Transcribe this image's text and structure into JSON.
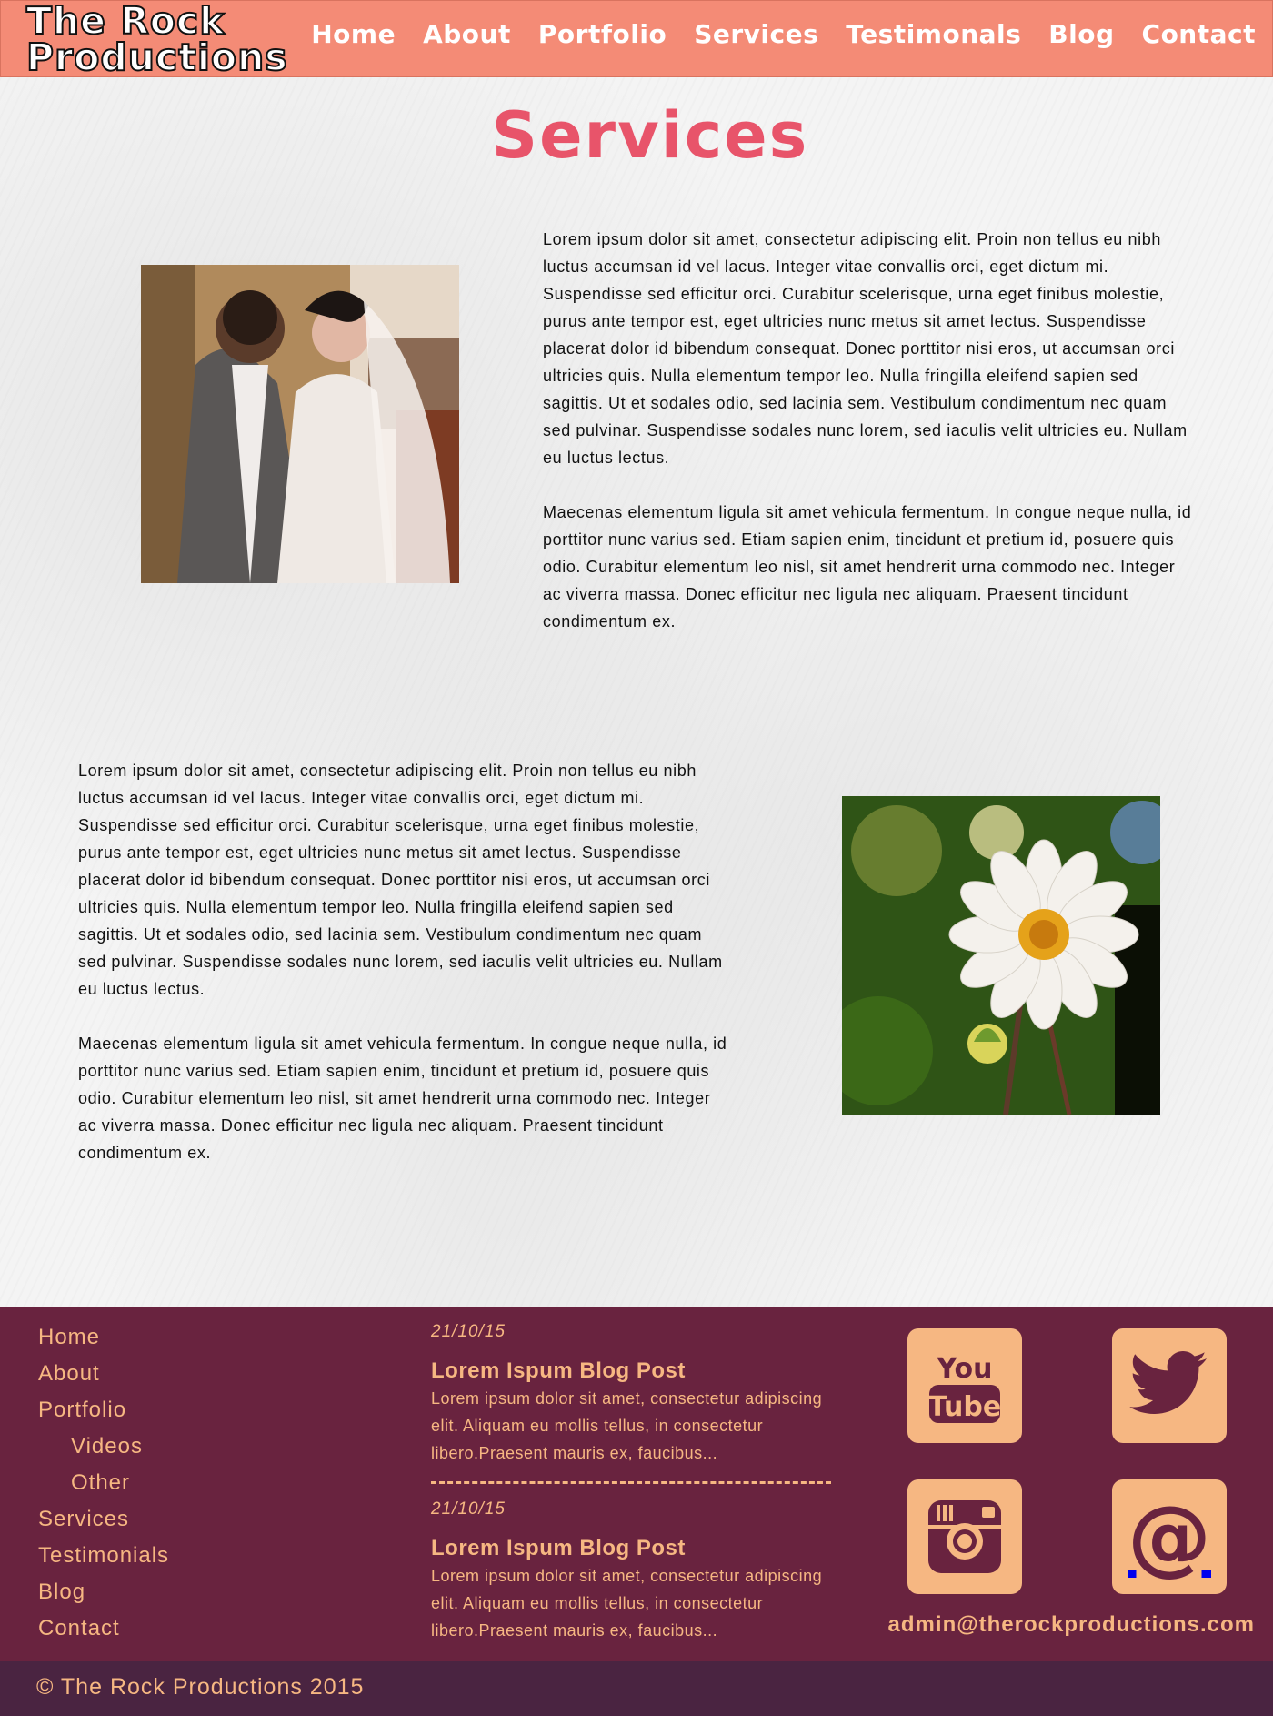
{
  "brand": {
    "line1": "The Rock",
    "line2": "Productions"
  },
  "nav": {
    "items": [
      {
        "label": "Home"
      },
      {
        "label": "About"
      },
      {
        "label": "Portfolio"
      },
      {
        "label": "Services"
      },
      {
        "label": "Testimonals"
      },
      {
        "label": "Blog"
      },
      {
        "label": "Contact"
      }
    ]
  },
  "main": {
    "title": "Services",
    "sections": [
      {
        "paragraphs": [
          "Lorem ipsum dolor sit amet, consectetur adipiscing elit. Proin non tellus eu nibh luctus accumsan id vel lacus. Integer vitae convallis orci, eget dictum mi. Suspendisse sed efficitur orci. Curabitur scelerisque, urna eget finibus molestie, purus ante tempor est, eget ultricies nunc metus sit amet lectus. Suspendisse placerat dolor id bibendum consequat. Donec porttitor nisi eros, ut accumsan orci ultricies quis. Nulla elementum tempor leo. Nulla fringilla eleifend sapien sed sagittis. Ut et sodales odio, sed lacinia sem. Vestibulum condimentum nec quam sed pulvinar. Suspendisse sodales nunc lorem, sed iaculis velit ultricies eu. Nullam eu luctus lectus.",
          "Maecenas elementum ligula sit amet vehicula fermentum. In congue neque nulla, id porttitor nunc varius sed. Etiam sapien enim, tincidunt et pretium id, posuere quis odio. Curabitur elementum leo nisl, sit amet hendrerit urna commodo nec. Integer ac viverra massa. Donec efficitur nec ligula nec aliquam. Praesent tincidunt condimentum ex."
        ]
      },
      {
        "paragraphs": [
          "Lorem ipsum dolor sit amet, consectetur adipiscing elit. Proin non tellus eu nibh luctus accumsan id vel lacus. Integer vitae convallis orci, eget dictum mi. Suspendisse sed efficitur orci. Curabitur scelerisque, urna eget finibus molestie, purus ante tempor est, eget ultricies nunc metus sit amet lectus. Suspendisse placerat dolor id bibendum consequat. Donec porttitor nisi eros, ut accumsan orci ultricies quis. Nulla elementum tempor leo. Nulla fringilla eleifend sapien sed sagittis. Ut et sodales odio, sed lacinia sem. Vestibulum condimentum nec quam sed pulvinar. Suspendisse sodales nunc lorem, sed iaculis velit ultricies eu. Nullam eu luctus lectus.",
          "Maecenas elementum ligula sit amet vehicula fermentum. In congue neque nulla, id porttitor nunc varius sed. Etiam sapien enim, tincidunt et pretium id, posuere quis odio. Curabitur elementum leo nisl, sit amet hendrerit urna commodo nec. Integer ac viverra massa. Donec efficitur nec ligula nec aliquam. Praesent tincidunt condimentum ex."
        ]
      }
    ]
  },
  "footer": {
    "nav": [
      {
        "label": "Home",
        "sub": false
      },
      {
        "label": "About",
        "sub": false
      },
      {
        "label": "Portfolio",
        "sub": false
      },
      {
        "label": "Videos",
        "sub": true
      },
      {
        "label": "Other",
        "sub": true
      },
      {
        "label": "Services",
        "sub": false
      },
      {
        "label": "Testimonials",
        "sub": false
      },
      {
        "label": "Blog",
        "sub": false
      },
      {
        "label": "Contact",
        "sub": false
      }
    ],
    "posts": [
      {
        "date": "21/10/15",
        "title": "Lorem Ispum Blog Post",
        "excerpt": "Lorem ipsum dolor sit amet, consectetur adipiscing elit. Aliquam eu mollis tellus, in consectetur libero.Praesent mauris ex, faucibus..."
      },
      {
        "date": "21/10/15",
        "title": "Lorem Ispum Blog Post",
        "excerpt": "Lorem ipsum dolor sit amet, consectetur adipiscing elit. Aliquam eu mollis tellus, in consectetur libero.Praesent mauris ex, faucibus..."
      }
    ],
    "social": {
      "youtube_line1": "You",
      "youtube_line2": "Tube",
      "at_symbol": "@",
      "icons": [
        "youtube-icon",
        "twitter-icon",
        "instagram-icon",
        "email-at-icon"
      ]
    },
    "email": "admin@therockproductions.com",
    "copyright": "© The Rock Productions 2015"
  },
  "colors": {
    "header_bg": "#f48b76",
    "title_accent": "#e8546a",
    "footer_bg": "#69233f",
    "footer_text": "#f6b782",
    "copyright_bg": "#4a2441"
  }
}
